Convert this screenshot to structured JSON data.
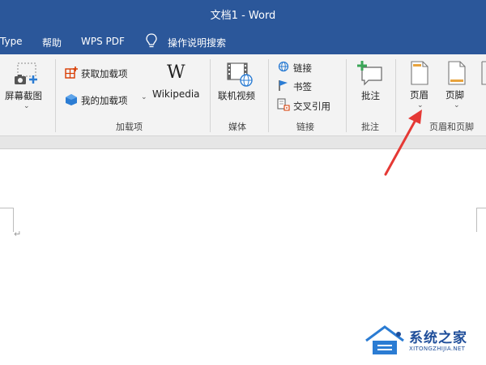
{
  "window": {
    "title": "文档1 - Word"
  },
  "menu": {
    "tabs": [
      "Type",
      "帮助",
      "WPS PDF"
    ],
    "tell_me": "操作说明搜索"
  },
  "ribbon": {
    "screenshot_label": "屏幕截图",
    "get_addins": "获取加载项",
    "my_addins": "我的加载项",
    "wikipedia_logo": "W",
    "wikipedia": "Wikipedia",
    "online_video": "联机视频",
    "link": "链接",
    "bookmark": "书签",
    "cross_ref": "交叉引用",
    "comment": "批注",
    "header": "页眉",
    "footer": "页脚",
    "groups": {
      "addins": "加载项",
      "media": "媒体",
      "links": "链接",
      "comments": "批注",
      "header_footer": "页眉和页脚"
    }
  },
  "watermark": {
    "title": "系统之家",
    "subtitle": "XITONGZHIJIA.NET"
  },
  "colors": {
    "titlebar": "#2b579a",
    "arrow": "#e53935",
    "accent": "#d83b01"
  }
}
